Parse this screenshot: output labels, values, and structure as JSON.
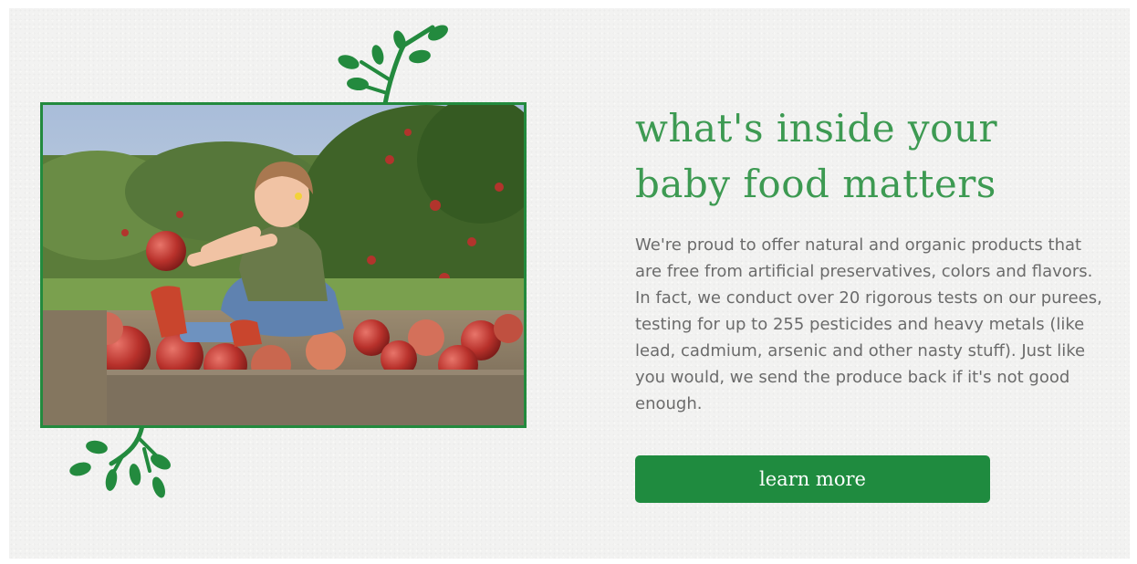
{
  "headline": {
    "line1": "what's inside your",
    "line2": "baby food matters"
  },
  "body_text": "We're proud to offer natural and organic products that are free from artificial preservatives, colors and flavors. In fact, we conduct over 20 rigorous tests on our purees, testing for up to 255 pesticides and heavy metals (like lead, cadmium, arsenic and other nasty stuff). Just like you would, we send the produce back if it's not good enough.",
  "cta": {
    "label": "learn more"
  },
  "photo": {
    "icon": "baby-in-apple-crate-photo"
  },
  "colors": {
    "accent": "#238a3e",
    "heading": "#3d9a52",
    "body": "#6b6b6b",
    "button": "#1f8b3f",
    "background": "#f2f2f1"
  }
}
